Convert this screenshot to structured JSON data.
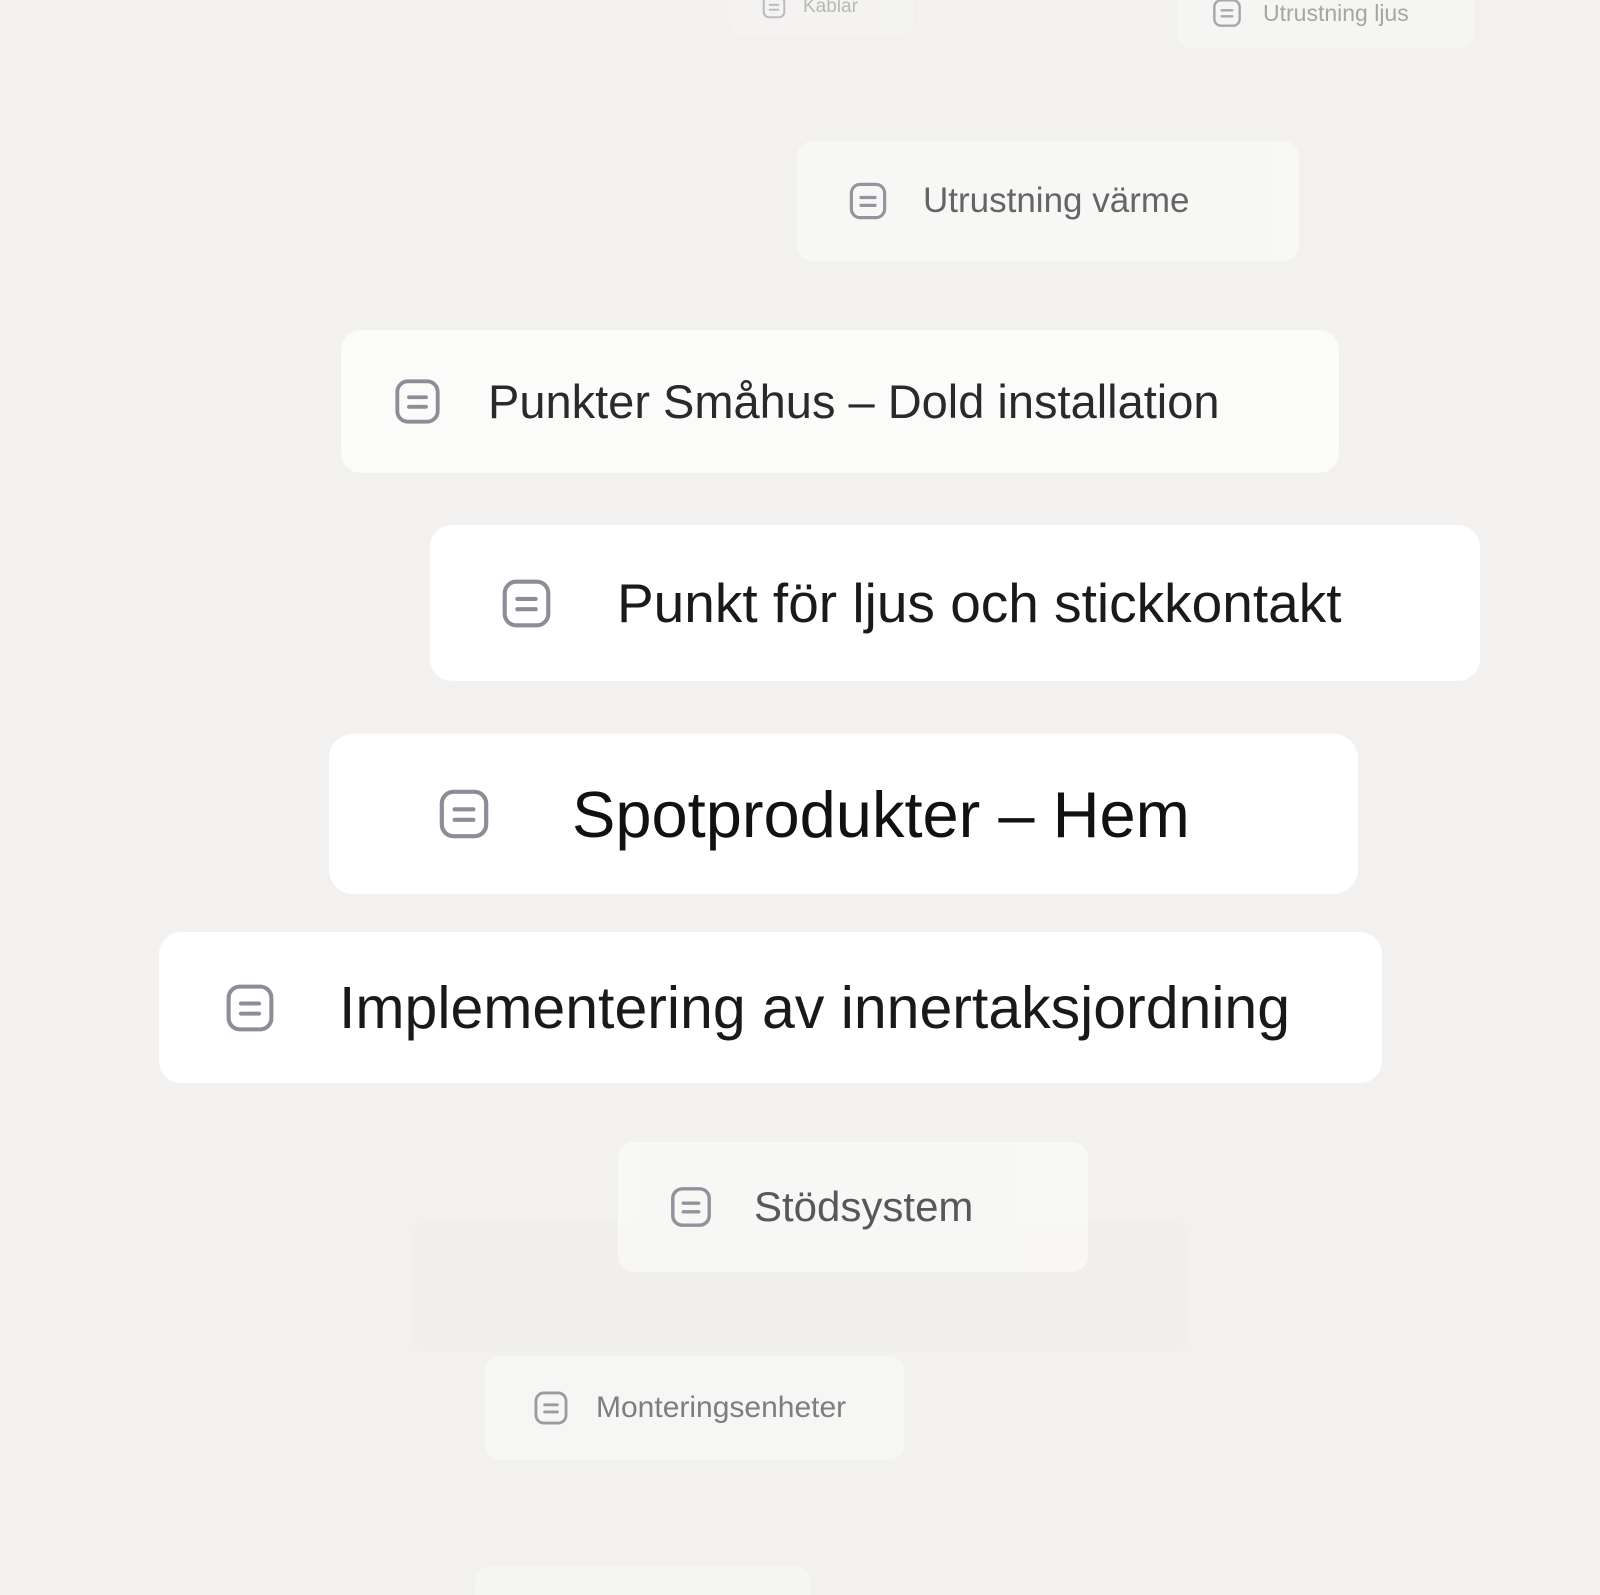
{
  "cards": [
    {
      "label": "Kablar",
      "icon": "document-icon"
    },
    {
      "label": "Utrustning ljus",
      "icon": "document-icon"
    },
    {
      "label": "Utrustning värme",
      "icon": "document-icon"
    },
    {
      "label": "Punkter Småhus – Dold installation",
      "icon": "document-icon"
    },
    {
      "label": "Punkt för ljus och stickkontakt",
      "icon": "document-icon"
    },
    {
      "label": "Spotprodukter – Hem",
      "icon": "document-icon"
    },
    {
      "label": "Implementering av innertaksjordning",
      "icon": "document-icon"
    },
    {
      "label": "Stödsystem",
      "icon": "document-icon"
    },
    {
      "label": "Monteringsenheter",
      "icon": "document-icon"
    },
    {
      "label": "",
      "icon": "document-icon"
    }
  ],
  "colors": {
    "background": "#f2f1ef",
    "card": "#ffffff",
    "icon_stroke": "#8d8d98",
    "text": "#1c1c1e"
  }
}
